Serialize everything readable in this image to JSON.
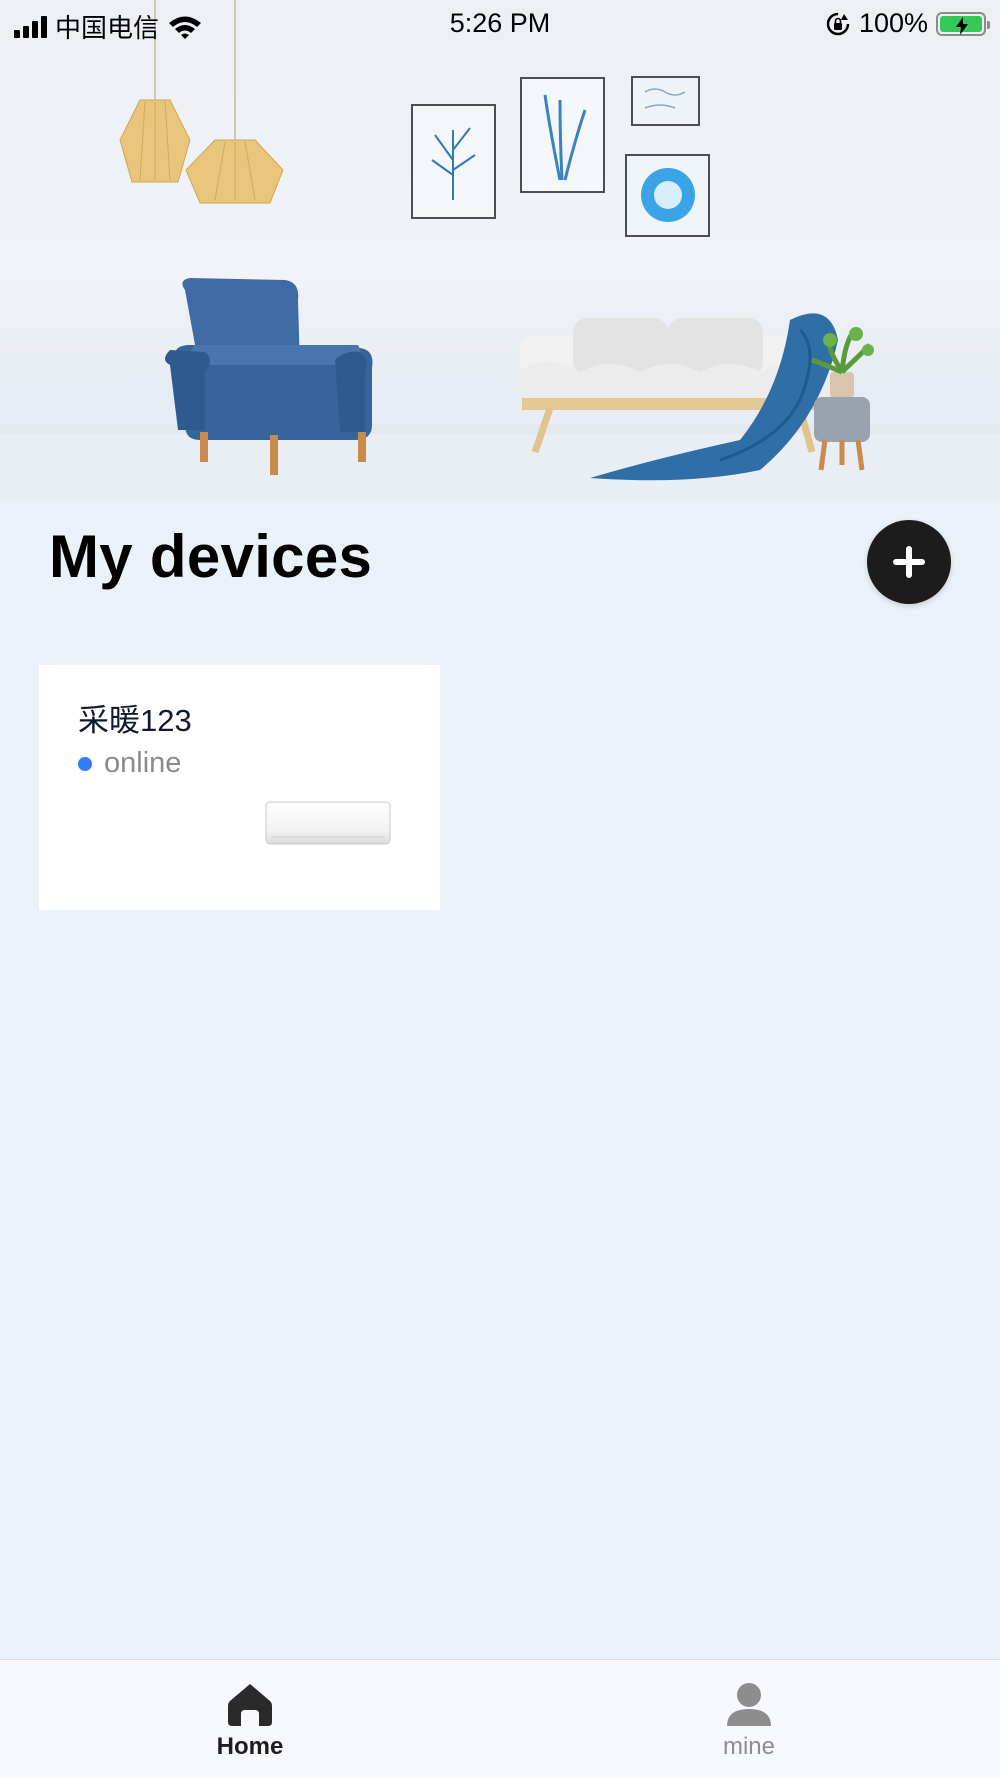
{
  "status_bar": {
    "carrier": "中国电信",
    "time": "5:26 PM",
    "battery_percent": "100%",
    "signal_bars": 4,
    "battery_level": 1.0
  },
  "hero": {
    "icons": [
      "pendant-lamp-icon",
      "framed-art-icon",
      "armchair-icon",
      "sofa-icon",
      "plant-icon",
      "stool-icon"
    ]
  },
  "header": {
    "title": "My devices",
    "add_icon": "plus-icon"
  },
  "devices": [
    {
      "name": "采暖123",
      "status": "online",
      "status_color": "#2f7cf6",
      "image_icon": "air-conditioner-icon"
    }
  ],
  "tab_bar": {
    "tabs": [
      {
        "label": "Home",
        "icon": "home-icon",
        "active": true
      },
      {
        "label": "mine",
        "icon": "person-icon",
        "active": false
      }
    ]
  },
  "colors": {
    "background": "#ebf1f9",
    "accent_dark": "#1c1c1c",
    "online_dot": "#2f7cf6",
    "battery_green": "#35c75a"
  }
}
